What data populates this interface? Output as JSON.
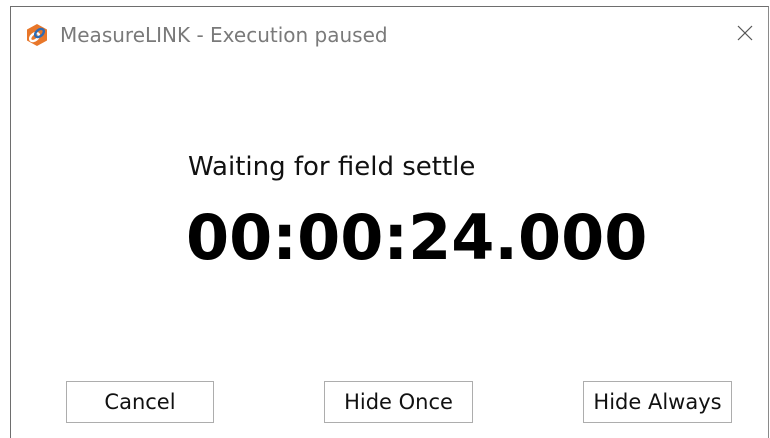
{
  "window": {
    "title": "MeasureLINK - Execution paused",
    "app_icon": "measurelink-logo-icon",
    "close_icon": "close-icon",
    "close_glyph": "✕"
  },
  "main": {
    "message": "Waiting for field settle",
    "timer": "00:00:24.000"
  },
  "buttons": {
    "cancel_label": "Cancel",
    "hide_once_label": "Hide Once",
    "hide_always_label": "Hide Always"
  },
  "colors": {
    "logo_orange": "#e8772a",
    "logo_blue": "#2f6bb3"
  }
}
